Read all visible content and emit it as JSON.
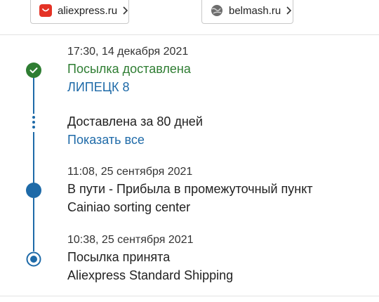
{
  "stores": [
    {
      "label": "aliexpress.ru",
      "icon": "aliexpress-logo-icon",
      "color": "#e43225"
    },
    {
      "label": "belmash.ru",
      "icon": "globe-icon",
      "color": "#555555"
    }
  ],
  "timeline": {
    "accent_color": "#1e6aa8",
    "delivered_color": "#2e7d32",
    "events": [
      {
        "time": "17:30, 14 декабря 2021",
        "status": "Посылка доставлена",
        "location": "ЛИПЕЦК 8"
      },
      {
        "summary": "Доставлена за 80 дней",
        "show_all": "Показать все"
      },
      {
        "time": "11:08, 25 сентября 2021",
        "status": "В пути - Прибыла в промежуточный пункт",
        "location": "Cainiao sorting center"
      },
      {
        "time": "10:38, 25 сентября 2021",
        "status": "Посылка принята",
        "location": "Aliexpress Standard Shipping"
      }
    ]
  }
}
